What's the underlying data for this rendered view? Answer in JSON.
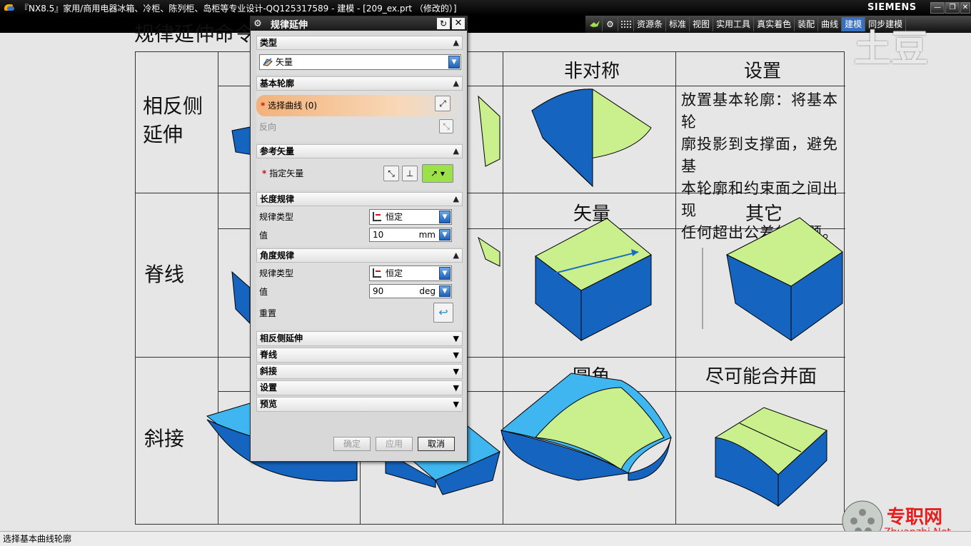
{
  "window": {
    "title": "『NX8.5』家用/商用电器冰箱、冷柜、陈列柜、岛柜等专业设计-QQ125317589 - 建模 - [209_ex.prt （修改的）]",
    "brand": "SIEMENS",
    "controls": [
      "—",
      "❐",
      "✕"
    ]
  },
  "toolbar": {
    "items": [
      "资源条",
      "标准",
      "视图",
      "实用工具",
      "真实着色",
      "装配",
      "曲线",
      "建模",
      "同步建模"
    ],
    "active": "建模"
  },
  "slide": {
    "title": "规律延伸命令说明",
    "header_cells": [
      "非对称",
      "设置",
      "矢量",
      "其它",
      "圆角",
      "尽可能合并面"
    ],
    "row_labels": [
      "相反侧延伸",
      "脊线",
      "斜接"
    ],
    "settings_desc": [
      "放置基本轮廓：将基本轮",
      "廓投影到支撑面，避免基",
      "本轮廓和约束面之间出现",
      "任何超出公差的问题。"
    ]
  },
  "dialog": {
    "title": "规律延伸",
    "sections": {
      "type": {
        "label": "类型",
        "value": "矢量"
      },
      "base_profile": {
        "label": "基本轮廓",
        "select_curve": "选择曲线 (0)",
        "reverse": "反向"
      },
      "ref_vector": {
        "label": "参考矢量",
        "specify": "指定矢量"
      },
      "length_law": {
        "label": "长度规律",
        "law_type_label": "规律类型",
        "law_type_value": "恒定",
        "value_label": "值",
        "value": "10",
        "unit": "mm"
      },
      "angle_law": {
        "label": "角度规律",
        "law_type_label": "规律类型",
        "law_type_value": "恒定",
        "value_label": "值",
        "value": "90",
        "unit": "deg",
        "reset_label": "重置"
      }
    },
    "collapsed": [
      "相反侧延伸",
      "脊线",
      "斜接",
      "设置",
      "预览"
    ],
    "buttons": {
      "ok": "确定",
      "apply": "应用",
      "cancel": "取消"
    }
  },
  "status": {
    "text": "选择基本曲线轮廓"
  },
  "watermark": {
    "tudou": "土豆",
    "site_cn": "专职网",
    "site_en": "Zhuanzhi.Net"
  },
  "colors": {
    "surface_green": "#c9f08c",
    "surface_blue": "#1565c0",
    "surface_cyan": "#3fb6f0",
    "highlight_orange": "#f3b27a"
  }
}
